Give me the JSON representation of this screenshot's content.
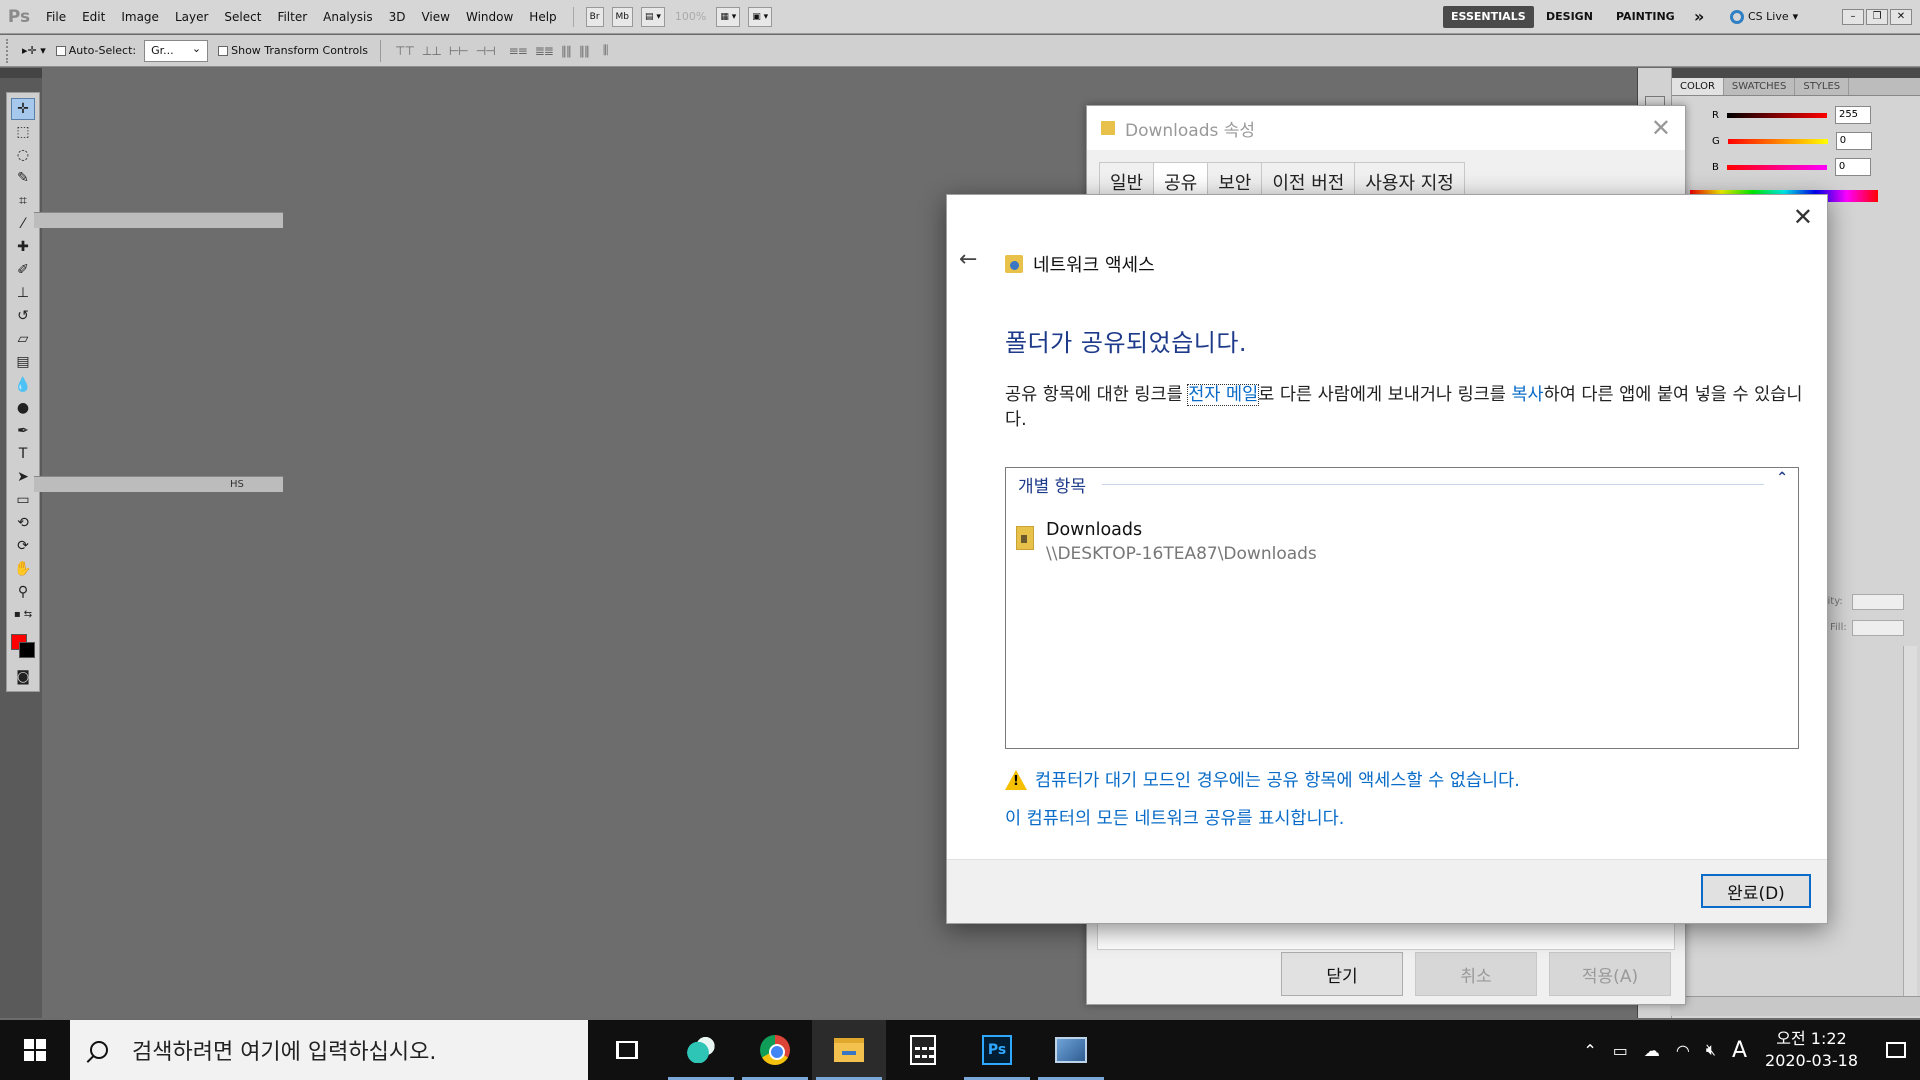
{
  "photoshop": {
    "logo": "Ps",
    "menu": [
      "File",
      "Edit",
      "Image",
      "Layer",
      "Select",
      "Filter",
      "Analysis",
      "3D",
      "View",
      "Window",
      "Help"
    ],
    "toolbar_icons": {
      "bridge": "Br",
      "minibridge": "Mb"
    },
    "zoom": "100%",
    "workspaces": {
      "active": "ESSENTIALS",
      "design": "DESIGN",
      "painting": "PAINTING",
      "more": "»"
    },
    "cs_live": "CS Live",
    "options": {
      "auto_select_label": "Auto-Select:",
      "auto_select_value": "Gr...",
      "show_transform": "Show Transform Controls"
    },
    "panels": {
      "tabs": [
        "COLOR",
        "SWATCHES",
        "STYLES"
      ],
      "active_tab": "COLOR",
      "color": {
        "r_label": "R",
        "r_value": "255",
        "g_label": "G",
        "g_value": "0",
        "b_label": "B",
        "b_value": "0",
        "foreground": "#ff0000",
        "background": "#000000"
      },
      "layers_partial": {
        "opacity_label": "city:",
        "fill_label": "Fill:",
        "tab_partial": "HS"
      }
    }
  },
  "properties_dialog": {
    "title": "Downloads 속성",
    "tabs": [
      "일반",
      "공유",
      "보안",
      "이전 버전",
      "사용자 지정"
    ],
    "active_tab": "공유",
    "buttons": {
      "close": "닫기",
      "cancel": "취소",
      "apply": "적용(A)"
    }
  },
  "share_dialog": {
    "header": "네트워크 액세스",
    "title": "폴더가 공유되었습니다.",
    "desc_part1": "공유 항목에 대한 링크를 ",
    "desc_link_email": "전자 메일",
    "desc_part2": "로 다른 사람에게 보내거나 링크를 ",
    "desc_link_copy": "복사",
    "desc_part3": "하여 다른 앱에 붙여 넣을 수 있습니다.",
    "items_header": "개별 항목",
    "item": {
      "name": "Downloads",
      "path": "\\\\DESKTOP-16TEA87\\Downloads"
    },
    "warning": "컴퓨터가 대기 모드인 경우에는 공유 항목에 액세스할 수 없습니다.",
    "show_all": "이 컴퓨터의 모든 네트워크 공유를 표시합니다.",
    "done_button": "완료(D)"
  },
  "taskbar": {
    "search_placeholder": "검색하려면 여기에 입력하십시오.",
    "apps": [
      "task-view",
      "bird-app",
      "chrome",
      "file-explorer",
      "calculator",
      "photoshop",
      "remote-desktop"
    ],
    "ps_label": "Ps",
    "ime": "A",
    "time": "오전 1:22",
    "date": "2020-03-18"
  }
}
